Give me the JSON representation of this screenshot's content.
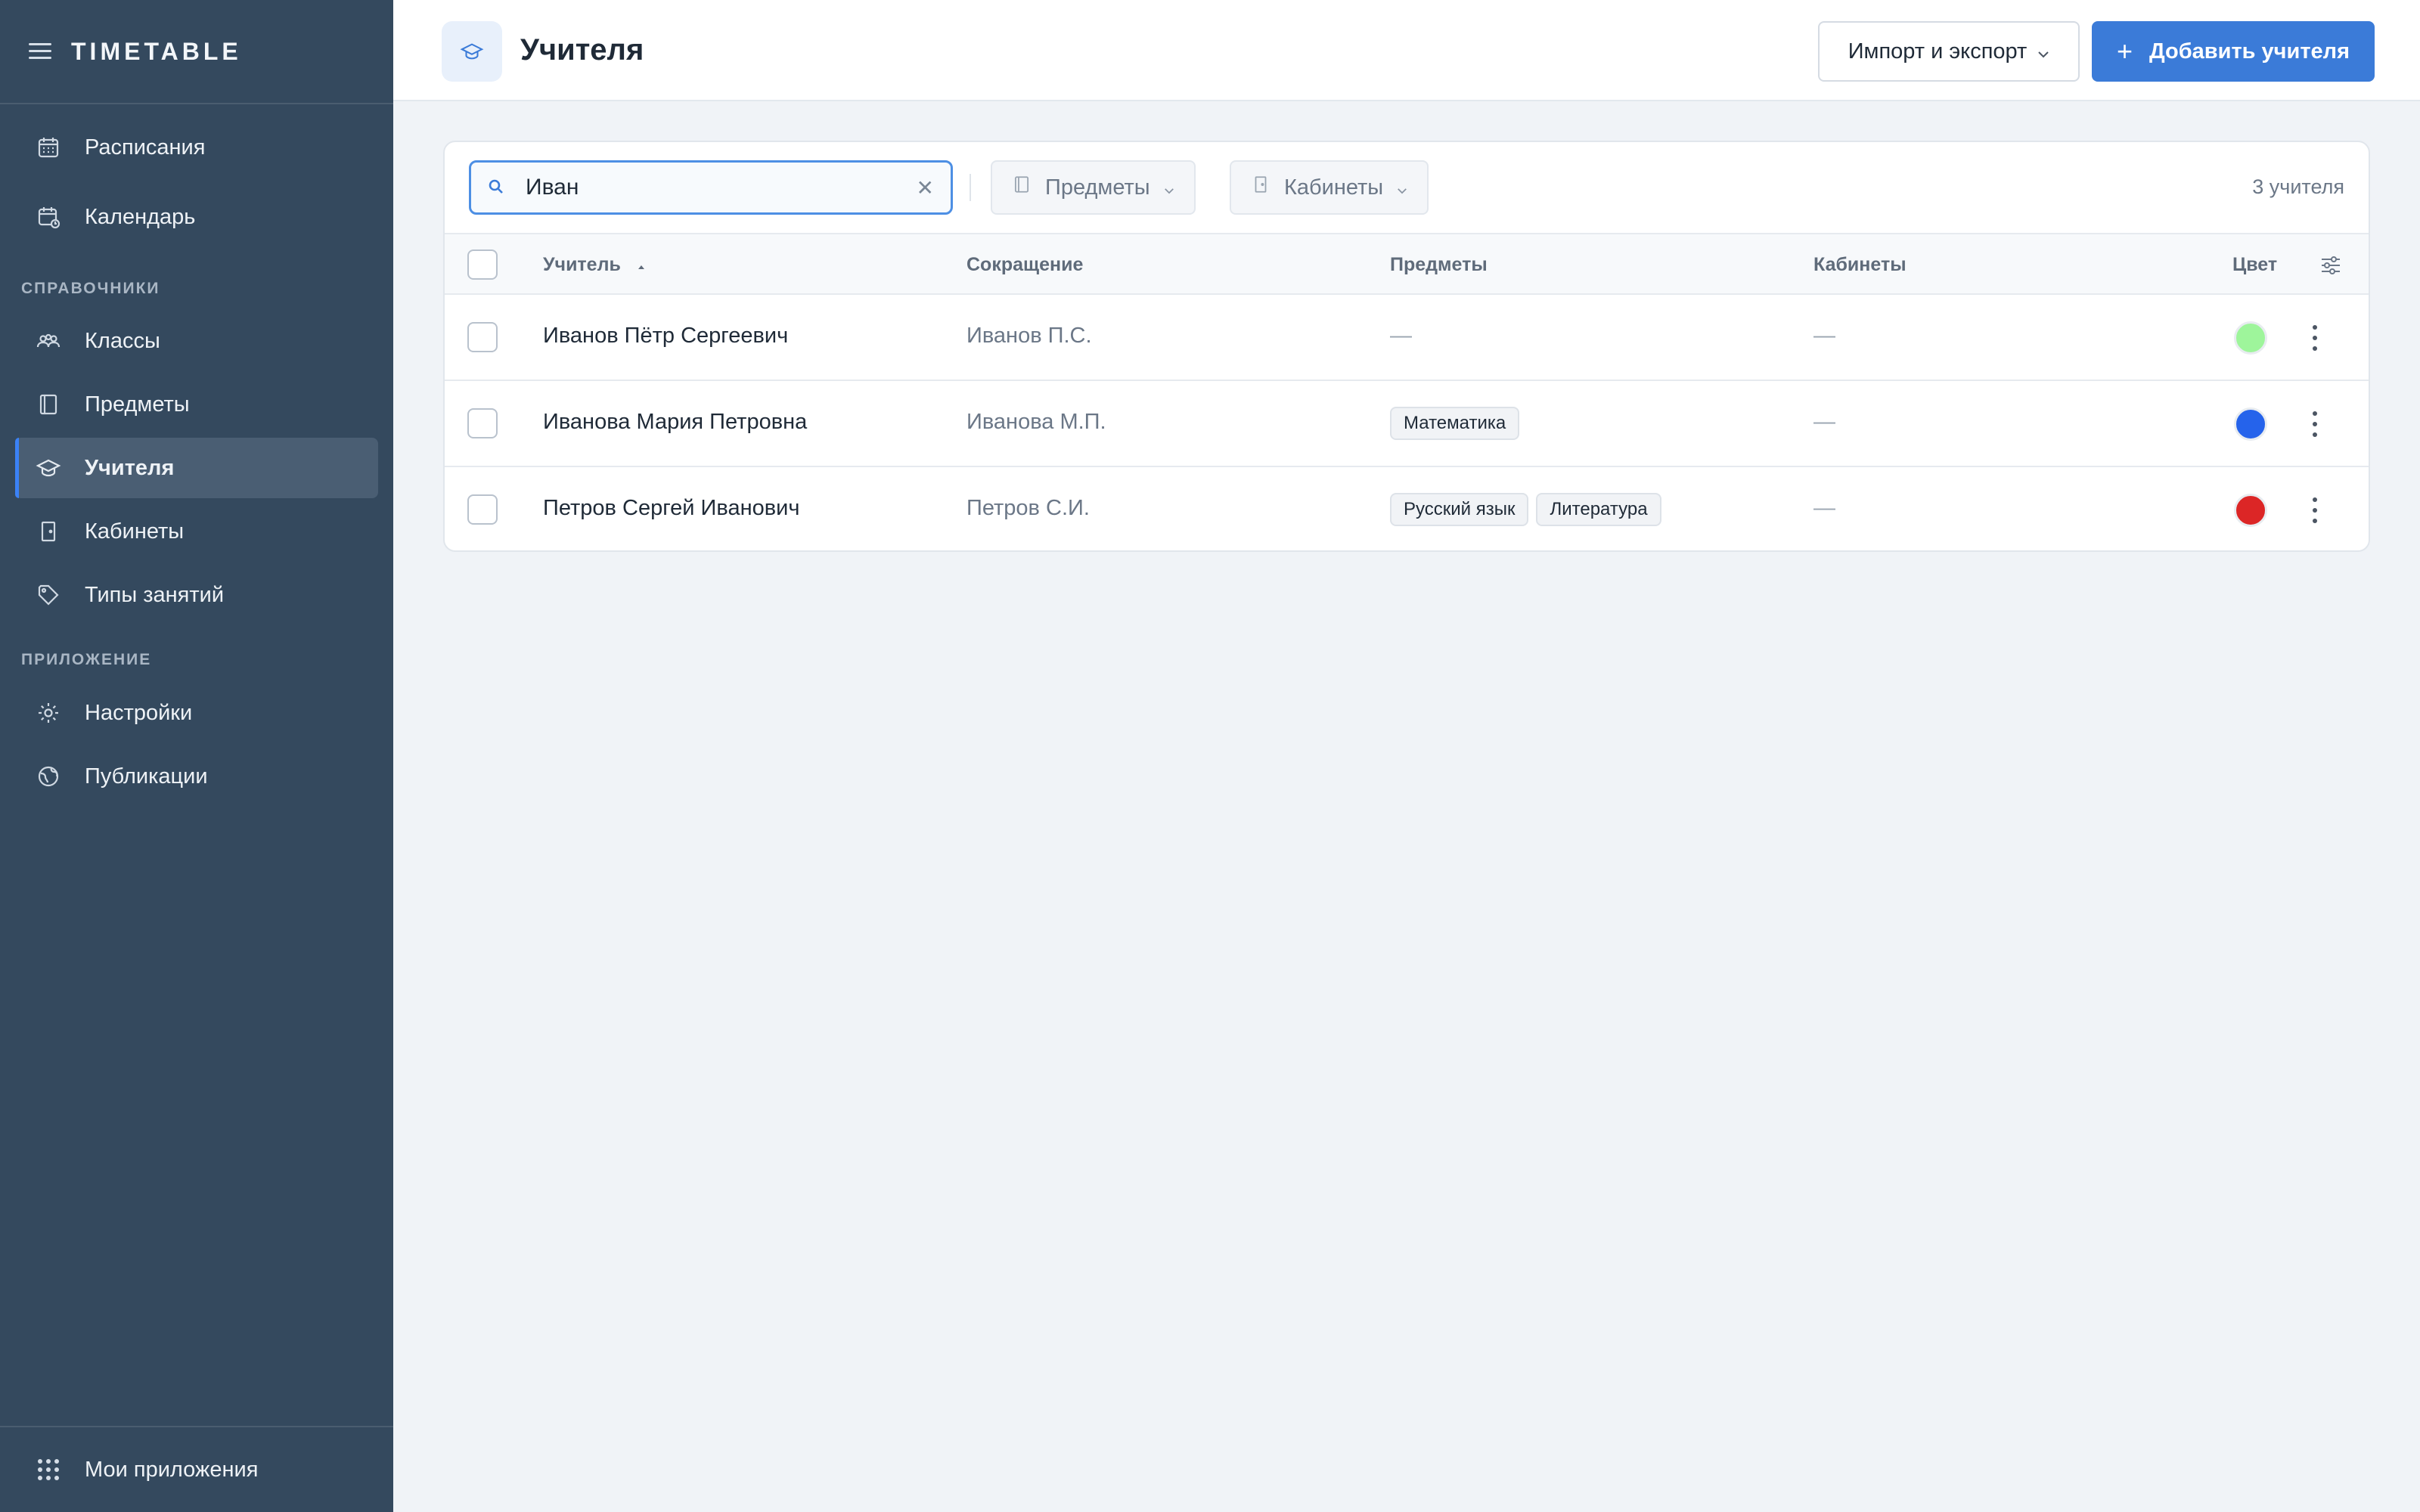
{
  "app": {
    "brand": "TIMETABLE"
  },
  "sidebar": {
    "items_top": [
      {
        "label": "Расписания",
        "icon": "calendar-grid-icon"
      },
      {
        "label": "Календарь",
        "icon": "calendar-clock-icon"
      }
    ],
    "section_refs": "СПРАВОЧНИКИ",
    "items_refs": [
      {
        "label": "Классы",
        "icon": "people-icon"
      },
      {
        "label": "Предметы",
        "icon": "book-icon"
      },
      {
        "label": "Учителя",
        "icon": "graduation-cap-icon",
        "active": true
      },
      {
        "label": "Кабинеты",
        "icon": "door-icon"
      },
      {
        "label": "Типы занятий",
        "icon": "tag-icon"
      }
    ],
    "section_app": "ПРИЛОЖЕНИЕ",
    "items_app": [
      {
        "label": "Настройки",
        "icon": "gear-icon"
      },
      {
        "label": "Публикации",
        "icon": "globe-icon"
      }
    ],
    "footer": {
      "label": "Мои приложения",
      "icon": "apps-grid-icon"
    }
  },
  "header": {
    "title": "Учителя",
    "import_label": "Импорт и экспорт",
    "add_label": "Добавить учителя"
  },
  "toolbar": {
    "search_value": "Иван",
    "filter_subjects": "Предметы",
    "filter_rooms": "Кабинеты",
    "count": "3 учителя"
  },
  "table": {
    "columns": {
      "teacher": "Учитель",
      "abbr": "Сокращение",
      "subjects": "Предметы",
      "rooms": "Кабинеты",
      "color": "Цвет"
    },
    "rows": [
      {
        "name": "Иванов Пётр Сергеевич",
        "abbr": "Иванов П.С.",
        "subjects": [],
        "subjects_empty": "—",
        "rooms": "—",
        "color": "#9ef59b"
      },
      {
        "name": "Иванова Мария Петровна",
        "abbr": "Иванова М.П.",
        "subjects": [
          "Математика"
        ],
        "subjects_empty": "",
        "rooms": "—",
        "color": "#2563eb"
      },
      {
        "name": "Петров Сергей Иванович",
        "abbr": "Петров С.И.",
        "subjects": [
          "Русский язык",
          "Литература"
        ],
        "subjects_empty": "",
        "rooms": "—",
        "color": "#dc2626"
      }
    ]
  },
  "colors": {
    "accent": "#3b7bd8",
    "sidebar_bg": "#34495e",
    "active_indicator": "#3b82f6"
  }
}
